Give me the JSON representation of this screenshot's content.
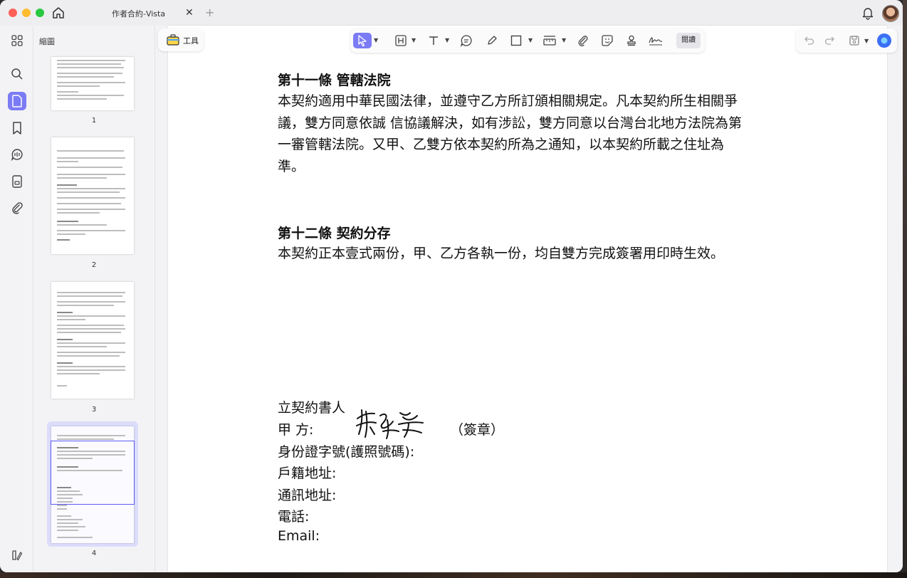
{
  "window": {
    "tab_title": "作者合約-Vista"
  },
  "sidebar": {
    "panel_title": "縮圖"
  },
  "thumbnails": [
    {
      "page": "1"
    },
    {
      "page": "2"
    },
    {
      "page": "3"
    },
    {
      "page": "4",
      "selected": true
    }
  ],
  "toolbar": {
    "tools_label": "工具",
    "read_label": "閱讀"
  },
  "document": {
    "sec11_title": "第十一條  管轄法院",
    "sec11_body_1": "本契約適用中華民國法律，並遵守乙方所訂頒相關規定。凡本契約所生相關爭",
    "sec11_body_2": "議，雙方同意依誠 信協議解決，如有涉訟，雙方同意以台灣台北地方法院為第",
    "sec11_body_3": "一審管轄法院。又甲、乙雙方依本契約所為之通知，以本契約所載之住址為",
    "sec11_body_4": "準。",
    "sec12_title": "第十二條  契約分存",
    "sec12_body": "本契約正本壹式兩份，甲、乙方各執一份，均自雙方完成簽署用印時生效。",
    "signer_heading": "立契約書人",
    "party_a": "甲  方:",
    "signature_note": "（簽章）",
    "id_no": "身份證字號(護照號碼):",
    "registered_addr": "戶籍地址:",
    "mailing_addr": "通訊地址:",
    "phone": "電話:",
    "email": "Email:"
  },
  "colors": {
    "accent": "#6b6bf3",
    "selected_thumb_bg": "#dcdcfb"
  }
}
